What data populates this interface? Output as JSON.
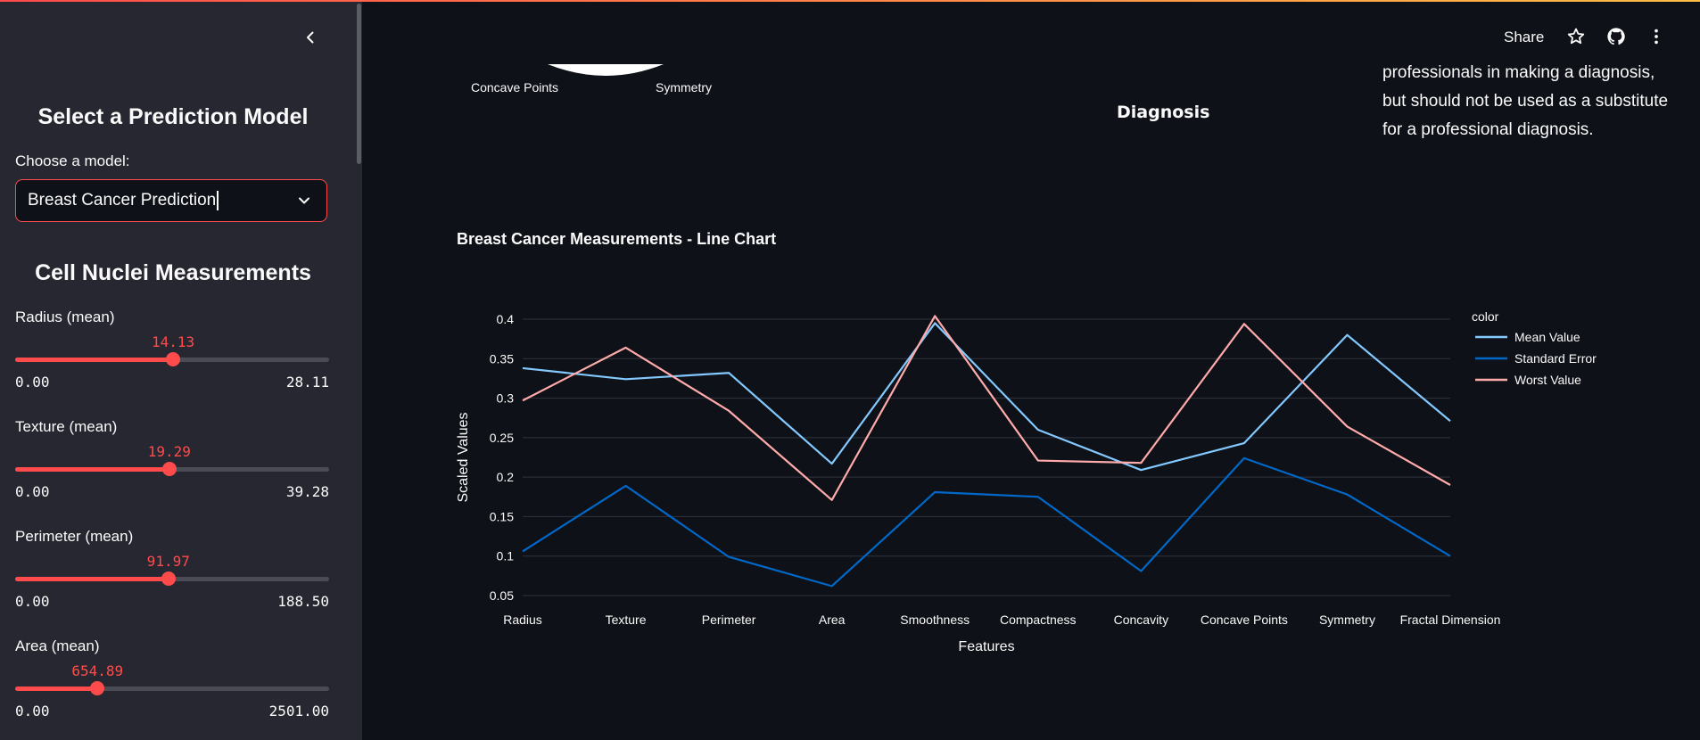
{
  "sidebar": {
    "model_heading": "Select a Prediction Model",
    "model_label": "Choose a model:",
    "model_value": "Breast Cancer Prediction",
    "measurements_heading": "Cell Nuclei Measurements",
    "sliders": [
      {
        "label": "Radius (mean)",
        "value": "14.13",
        "min": "0.00",
        "max": "28.11",
        "fraction": 0.503
      },
      {
        "label": "Texture (mean)",
        "value": "19.29",
        "min": "0.00",
        "max": "39.28",
        "fraction": 0.491
      },
      {
        "label": "Perimeter (mean)",
        "value": "91.97",
        "min": "0.00",
        "max": "188.50",
        "fraction": 0.488
      },
      {
        "label": "Area (mean)",
        "value": "654.89",
        "min": "0.00",
        "max": "2501.00",
        "fraction": 0.262
      }
    ]
  },
  "header": {
    "share_label": "Share",
    "icons": [
      "star-icon",
      "github-icon",
      "more-vertical-icon"
    ]
  },
  "main": {
    "gauge_labels": [
      "Concave Points",
      "Symmetry"
    ],
    "diagnosis_label": "Diagnosis",
    "disclaimer": "professionals in making a diagnosis, but should not be used as a substitute for a professional diagnosis."
  },
  "chart_data": {
    "type": "line",
    "title": "Breast Cancer Measurements - Line Chart",
    "xlabel": "Features",
    "ylabel": "Scaled Values",
    "legend_title": "color",
    "legend_position": "right",
    "grid": true,
    "categories": [
      "Radius",
      "Texture",
      "Perimeter",
      "Area",
      "Smoothness",
      "Compactness",
      "Concavity",
      "Concave Points",
      "Symmetry",
      "Fractal Dimension"
    ],
    "ylim": [
      0.05,
      0.4
    ],
    "yticks": [
      "0.05",
      "0.1",
      "0.15",
      "0.2",
      "0.25",
      "0.3",
      "0.35",
      "0.4"
    ],
    "series": [
      {
        "name": "Mean Value",
        "color": "#83c9ff",
        "values": [
          0.338,
          0.324,
          0.332,
          0.217,
          0.395,
          0.26,
          0.209,
          0.243,
          0.38,
          0.271
        ]
      },
      {
        "name": "Standard Error",
        "color": "#0068c9",
        "values": [
          0.106,
          0.189,
          0.099,
          0.062,
          0.181,
          0.175,
          0.081,
          0.224,
          0.178,
          0.1
        ]
      },
      {
        "name": "Worst Value",
        "color": "#ffabab",
        "values": [
          0.297,
          0.364,
          0.284,
          0.171,
          0.404,
          0.221,
          0.218,
          0.394,
          0.264,
          0.19
        ]
      }
    ]
  }
}
